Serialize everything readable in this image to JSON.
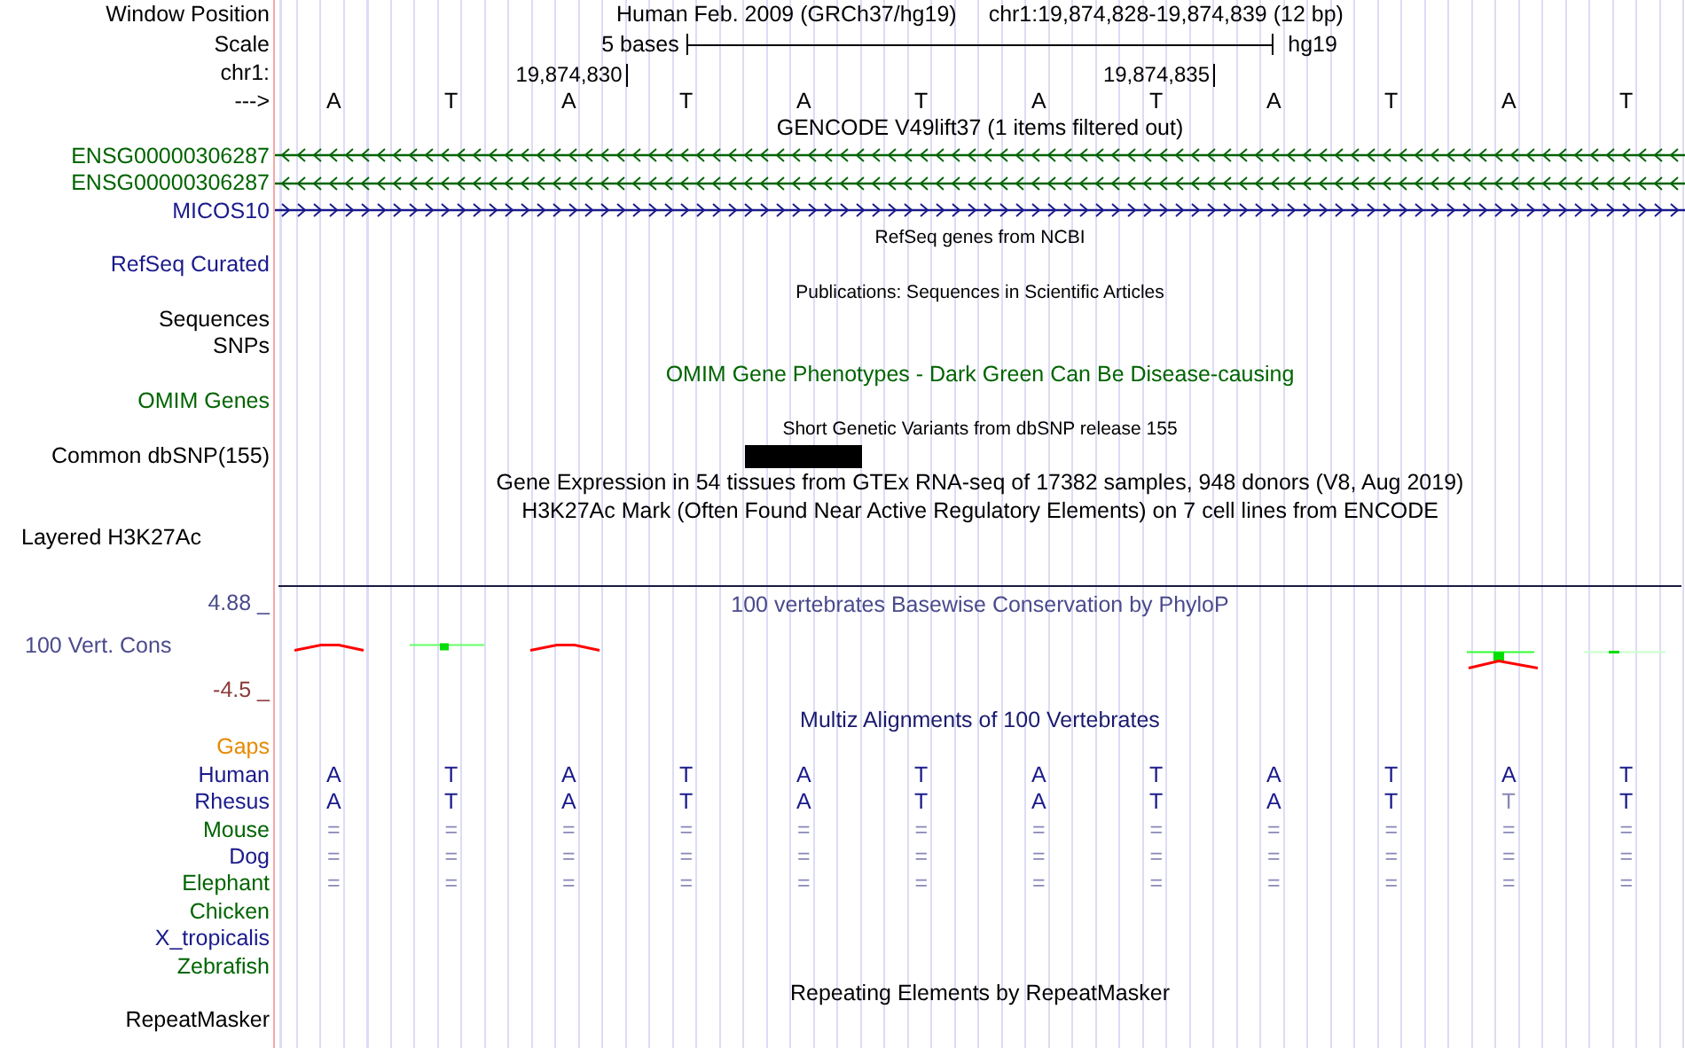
{
  "position": {
    "label": "Window Position",
    "assembly": "Human Feb. 2009 (GRCh37/hg19)",
    "range": "chr1:19,874,828-19,874,839 (12 bp)"
  },
  "scale": {
    "label": "Scale",
    "length": "5 bases",
    "db": "hg19"
  },
  "coordinates": {
    "label": "chr1:",
    "ticks": [
      "19,874,830",
      "19,874,835"
    ]
  },
  "sequence": {
    "label": "--->",
    "bases": [
      "A",
      "T",
      "A",
      "T",
      "A",
      "T",
      "A",
      "T",
      "A",
      "T",
      "A",
      "T"
    ]
  },
  "tracks": [
    {
      "kind": "title",
      "text": "GENCODE V49lift37 (1 items filtered out)",
      "color": "#000000"
    },
    {
      "kind": "gene",
      "label": "ENSG00000306287",
      "reverse": true,
      "color": "#006400"
    },
    {
      "kind": "gene",
      "label": "ENSG00000306287",
      "reverse": true,
      "color": "#006400"
    },
    {
      "kind": "gene",
      "label": "MICOS10",
      "reverse": false,
      "color": "#1a1a8c"
    },
    {
      "kind": "subtitle",
      "text": "RefSeq genes from NCBI"
    },
    {
      "kind": "label",
      "label": "RefSeq Curated",
      "color": "#1a1a8c"
    },
    {
      "kind": "subtitle",
      "text": "Publications: Sequences in Scientific Articles"
    },
    {
      "kind": "label",
      "label": "Sequences",
      "color": "#000000"
    },
    {
      "kind": "label",
      "label": "SNPs",
      "color": "#000000"
    },
    {
      "kind": "title",
      "text": "OMIM Gene Phenotypes - Dark Green Can Be Disease-causing",
      "color": "#006400"
    },
    {
      "kind": "label",
      "label": "OMIM Genes",
      "color": "#006400"
    },
    {
      "kind": "subtitle",
      "text": "Short Genetic Variants from dbSNP release 155"
    },
    {
      "kind": "variants",
      "label": "Common dbSNP(155)",
      "color": "#000000",
      "blocks": [
        false,
        false,
        false,
        false,
        true,
        false,
        false,
        false,
        false,
        false,
        false,
        false
      ]
    },
    {
      "kind": "title",
      "text": "Gene Expression in 54 tissues from GTEx RNA-seq of 17382 samples, 948 donors (V8, Aug 2019)",
      "color": "#000000"
    },
    {
      "kind": "title",
      "text": "H3K27Ac Mark (Often Found Near Active Regulatory Elements) on 7 cell lines from ENCODE",
      "color": "#000000"
    },
    {
      "kind": "composite",
      "label": "Layered H3K27Ac",
      "color": "#000000"
    },
    {
      "kind": "conservation",
      "title": "100 vertebrates Basewise Conservation by PhyloP",
      "top": "4.88 _",
      "label": "100 Vert. Cons",
      "bottom": "-4.5 _"
    },
    {
      "kind": "title",
      "text": "Multiz Alignments of 100 Vertebrates",
      "color": "#1a1a6e"
    },
    {
      "kind": "label",
      "label": "Gaps",
      "color": "#e68a00"
    },
    {
      "kind": "alignment",
      "label": "Human",
      "color": "#1a1a8c",
      "cells": [
        {
          "text": "A",
          "dimmed": false
        },
        {
          "text": "T",
          "dimmed": false
        },
        {
          "text": "A",
          "dimmed": false
        },
        {
          "text": "T",
          "dimmed": false
        },
        {
          "text": "A",
          "dimmed": false
        },
        {
          "text": "T",
          "dimmed": false
        },
        {
          "text": "A",
          "dimmed": false
        },
        {
          "text": "T",
          "dimmed": false
        },
        {
          "text": "A",
          "dimmed": false
        },
        {
          "text": "T",
          "dimmed": false
        },
        {
          "text": "A",
          "dimmed": false
        },
        {
          "text": "T",
          "dimmed": false
        }
      ]
    },
    {
      "kind": "alignment",
      "label": "Rhesus",
      "color": "#1a1a8c",
      "cells": [
        {
          "text": "A",
          "dimmed": false
        },
        {
          "text": "T",
          "dimmed": false
        },
        {
          "text": "A",
          "dimmed": false
        },
        {
          "text": "T",
          "dimmed": false
        },
        {
          "text": "A",
          "dimmed": false
        },
        {
          "text": "T",
          "dimmed": false
        },
        {
          "text": "A",
          "dimmed": false
        },
        {
          "text": "T",
          "dimmed": false
        },
        {
          "text": "A",
          "dimmed": false
        },
        {
          "text": "T",
          "dimmed": false
        },
        {
          "text": "T",
          "dimmed": true
        },
        {
          "text": "T",
          "dimmed": false
        }
      ]
    },
    {
      "kind": "alignment",
      "label": "Mouse",
      "color": "#006400",
      "cells": [
        {
          "text": "=",
          "dimmed": true
        },
        {
          "text": "=",
          "dimmed": true
        },
        {
          "text": "=",
          "dimmed": true
        },
        {
          "text": "=",
          "dimmed": true
        },
        {
          "text": "=",
          "dimmed": true
        },
        {
          "text": "=",
          "dimmed": true
        },
        {
          "text": "=",
          "dimmed": true
        },
        {
          "text": "=",
          "dimmed": true
        },
        {
          "text": "=",
          "dimmed": true
        },
        {
          "text": "=",
          "dimmed": true
        },
        {
          "text": "=",
          "dimmed": true
        },
        {
          "text": "=",
          "dimmed": true
        }
      ]
    },
    {
      "kind": "alignment",
      "label": "Dog",
      "color": "#1a1a8c",
      "cells": [
        {
          "text": "=",
          "dimmed": true
        },
        {
          "text": "=",
          "dimmed": true
        },
        {
          "text": "=",
          "dimmed": true
        },
        {
          "text": "=",
          "dimmed": true
        },
        {
          "text": "=",
          "dimmed": true
        },
        {
          "text": "=",
          "dimmed": true
        },
        {
          "text": "=",
          "dimmed": true
        },
        {
          "text": "=",
          "dimmed": true
        },
        {
          "text": "=",
          "dimmed": true
        },
        {
          "text": "=",
          "dimmed": true
        },
        {
          "text": "=",
          "dimmed": true
        },
        {
          "text": "=",
          "dimmed": true
        }
      ]
    },
    {
      "kind": "alignment",
      "label": "Elephant",
      "color": "#006400",
      "cells": [
        {
          "text": "=",
          "dimmed": true
        },
        {
          "text": "=",
          "dimmed": true
        },
        {
          "text": "=",
          "dimmed": true
        },
        {
          "text": "=",
          "dimmed": true
        },
        {
          "text": "=",
          "dimmed": true
        },
        {
          "text": "=",
          "dimmed": true
        },
        {
          "text": "=",
          "dimmed": true
        },
        {
          "text": "=",
          "dimmed": true
        },
        {
          "text": "=",
          "dimmed": true
        },
        {
          "text": "=",
          "dimmed": true
        },
        {
          "text": "=",
          "dimmed": true
        },
        {
          "text": "=",
          "dimmed": true
        }
      ]
    },
    {
      "kind": "label",
      "label": "Chicken",
      "color": "#006400"
    },
    {
      "kind": "label",
      "label": "X_tropicalis",
      "color": "#1a1a8c"
    },
    {
      "kind": "label",
      "label": "Zebrafish",
      "color": "#006400"
    },
    {
      "kind": "title",
      "text": "Repeating Elements by RepeatMasker",
      "color": "#000000"
    },
    {
      "kind": "label",
      "label": "RepeatMasker",
      "color": "#000000"
    }
  ]
}
